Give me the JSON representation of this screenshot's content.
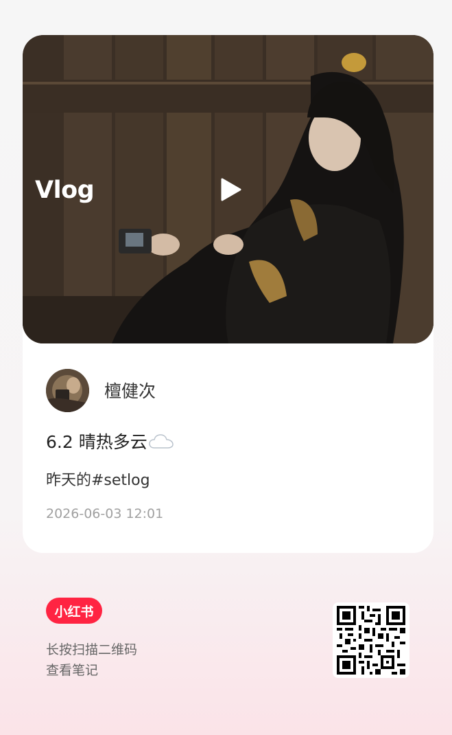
{
  "cover": {
    "badge_text": "Vlog",
    "play_icon": "play-icon"
  },
  "author": {
    "name": "檀健次",
    "avatar_icon": "avatar"
  },
  "post": {
    "title": "6.2 晴热多云",
    "title_emoji": "cloud-icon",
    "description": "昨天的#setlog",
    "date": "2026-06-03 12:01"
  },
  "footer": {
    "brand_label": "小红书",
    "scan_line1": "长按扫描二维码",
    "scan_line2": "查看笔记",
    "qr_icon": "qr-code-icon"
  },
  "colors": {
    "brand": "#ff2442",
    "card": "#ffffff",
    "meta_gray": "#a0a0a0"
  }
}
